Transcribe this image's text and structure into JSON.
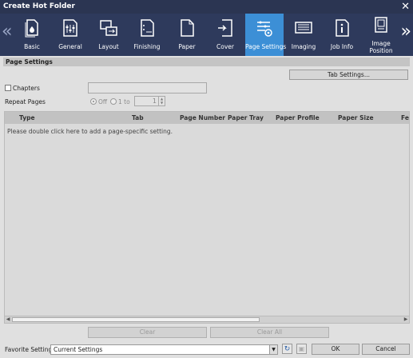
{
  "window": {
    "title": "Create Hot Folder"
  },
  "tabs": [
    {
      "label": "Basic",
      "icon": "basic-icon"
    },
    {
      "label": "General",
      "icon": "general-icon"
    },
    {
      "label": "Layout",
      "icon": "layout-icon"
    },
    {
      "label": "Finishing",
      "icon": "finishing-icon"
    },
    {
      "label": "Paper",
      "icon": "paper-icon"
    },
    {
      "label": "Cover",
      "icon": "cover-icon"
    },
    {
      "label": "Page Settings",
      "icon": "page-settings-icon",
      "active": true
    },
    {
      "label": "Imaging",
      "icon": "imaging-icon"
    },
    {
      "label": "Job Info",
      "icon": "job-info-icon"
    },
    {
      "label": "Image Position",
      "icon": "image-position-icon"
    }
  ],
  "section": {
    "title": "Page Settings"
  },
  "tab_settings_button": "Tab Settings...",
  "chapters": {
    "label": "Chapters",
    "checked": false,
    "value": ""
  },
  "repeat_pages": {
    "label": "Repeat Pages",
    "off_label": "Off",
    "one_to_label": "1 to",
    "value": "1"
  },
  "table": {
    "columns": [
      "Type",
      "Tab",
      "Page Number",
      "Paper Tray",
      "Paper Profile",
      "Paper Size",
      "Fee"
    ],
    "placeholder": "Please double click here to add a page-specific setting."
  },
  "buttons": {
    "clear": "Clear",
    "clear_all": "Clear All",
    "ok": "OK",
    "cancel": "Cancel"
  },
  "favorite": {
    "label": "Favorite Setting",
    "value": "Current Settings"
  },
  "colors": {
    "title_bg": "#2b3552",
    "tab_bg": "#2e3a5c",
    "active_tab": "#3c8fd6"
  }
}
